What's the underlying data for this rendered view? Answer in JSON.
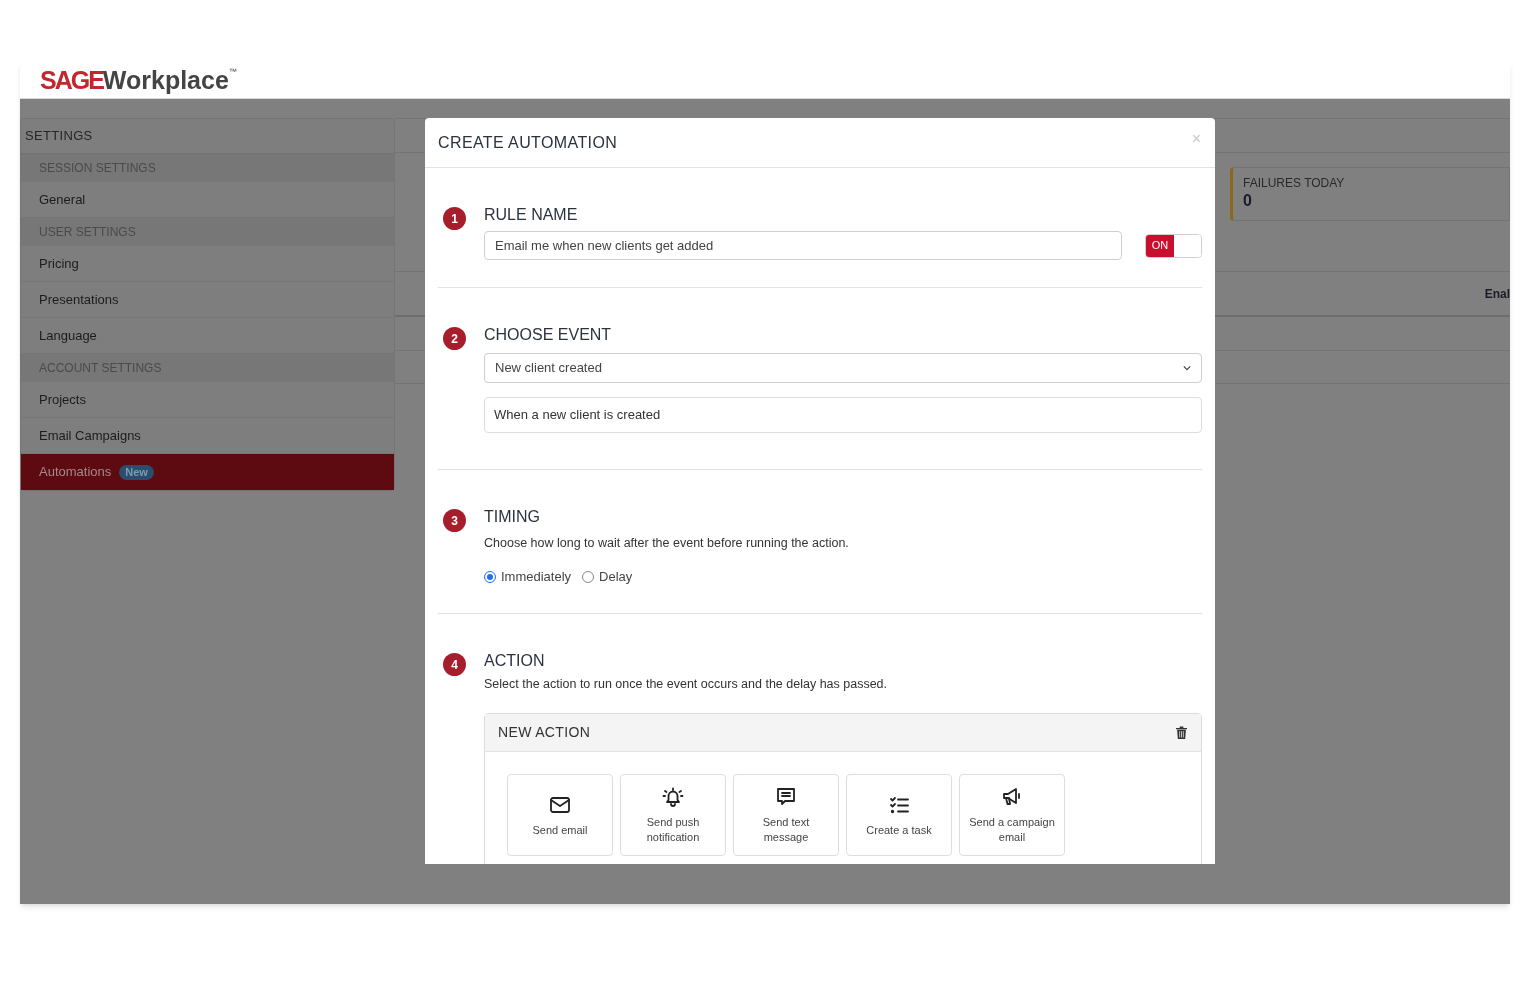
{
  "header": {
    "logo": {
      "mark": "SAGE",
      "name": "Workplace",
      "trademark": "™"
    }
  },
  "sidebar": {
    "title": "SETTINGS",
    "items": [
      {
        "kind": "group",
        "label": "SESSION SETTINGS"
      },
      {
        "kind": "link",
        "label": "General",
        "selected": false
      },
      {
        "kind": "group",
        "label": "USER SETTINGS"
      },
      {
        "kind": "link",
        "label": "Pricing",
        "selected": false
      },
      {
        "kind": "link",
        "label": "Presentations",
        "selected": false
      },
      {
        "kind": "link",
        "label": "Language",
        "selected": false
      },
      {
        "kind": "group",
        "label": "ACCOUNT SETTINGS"
      },
      {
        "kind": "link",
        "label": "Projects",
        "selected": false
      },
      {
        "kind": "link",
        "label": "Email Campaigns",
        "selected": false
      },
      {
        "kind": "link",
        "label": "Automations",
        "badge": "New",
        "selected": true
      }
    ]
  },
  "background": {
    "stat_card": {
      "label": "FAILURES TODAY",
      "value": "0"
    },
    "column_header": "Enal"
  },
  "modal": {
    "title": "CREATE AUTOMATION",
    "close": "×",
    "steps": [
      {
        "kind": "rule_name",
        "number": "1",
        "title": "RULE NAME",
        "value": "Email me when new clients get added",
        "toggle": {
          "label": "ON",
          "on": true
        }
      },
      {
        "kind": "event",
        "number": "2",
        "title": "CHOOSE EVENT",
        "value": "New client created",
        "description": "When a new client is created"
      },
      {
        "kind": "timing",
        "number": "3",
        "title": "TIMING",
        "description": "Choose how long to wait after the event before running the action.",
        "options": [
          {
            "label": "Immediately",
            "selected": true
          },
          {
            "label": "Delay",
            "selected": false
          }
        ]
      },
      {
        "kind": "action",
        "number": "4",
        "title": "ACTION",
        "description": "Select the action to run once the event occurs and the delay has passed.",
        "panel": {
          "title": "NEW ACTION",
          "actions": [
            {
              "kind": "email",
              "label": "Send email"
            },
            {
              "kind": "push",
              "label": "Send push notification"
            },
            {
              "kind": "text",
              "label": "Send text message"
            },
            {
              "kind": "task",
              "label": "Create a task"
            },
            {
              "kind": "campaign",
              "label": "Send a campaign email"
            }
          ]
        }
      }
    ]
  }
}
